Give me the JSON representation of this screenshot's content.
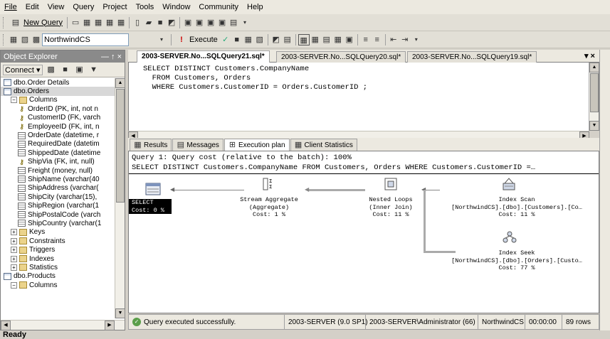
{
  "menu": [
    "File",
    "Edit",
    "View",
    "Query",
    "Project",
    "Tools",
    "Window",
    "Community",
    "Help"
  ],
  "toolbar1": {
    "new_query": "New Query"
  },
  "toolbar2": {
    "database": "NorthwindCS",
    "execute": "Execute"
  },
  "object_explorer": {
    "title": "Object Explorer",
    "pin": "— ↑ ×",
    "connect": "Connect ▾",
    "items": [
      {
        "label": "dbo.Order Details",
        "indent": 0,
        "icon": "table-icon",
        "expander": ""
      },
      {
        "label": "dbo.Orders",
        "indent": 0,
        "icon": "table-icon",
        "expander": "",
        "selected": true
      },
      {
        "label": "Columns",
        "indent": 1,
        "icon": "folder-icon",
        "expander": "−"
      },
      {
        "label": "OrderID (PK, int, not n",
        "indent": 2,
        "icon": "key-icon",
        "expander": ""
      },
      {
        "label": "CustomerID (FK, varch",
        "indent": 2,
        "icon": "key-icon",
        "expander": ""
      },
      {
        "label": "EmployeeID (FK, int, n",
        "indent": 2,
        "icon": "key-icon",
        "expander": ""
      },
      {
        "label": "OrderDate (datetime, r",
        "indent": 2,
        "icon": "column-icon",
        "expander": ""
      },
      {
        "label": "RequiredDate (datetim",
        "indent": 2,
        "icon": "column-icon",
        "expander": ""
      },
      {
        "label": "ShippedDate (datetime",
        "indent": 2,
        "icon": "column-icon",
        "expander": ""
      },
      {
        "label": "ShipVia (FK, int, null)",
        "indent": 2,
        "icon": "key-icon",
        "expander": ""
      },
      {
        "label": "Freight (money, null)",
        "indent": 2,
        "icon": "column-icon",
        "expander": ""
      },
      {
        "label": "ShipName (varchar(40",
        "indent": 2,
        "icon": "column-icon",
        "expander": ""
      },
      {
        "label": "ShipAddress (varchar(",
        "indent": 2,
        "icon": "column-icon",
        "expander": ""
      },
      {
        "label": "ShipCity (varchar(15), ",
        "indent": 2,
        "icon": "column-icon",
        "expander": ""
      },
      {
        "label": "ShipRegion (varchar(1",
        "indent": 2,
        "icon": "column-icon",
        "expander": ""
      },
      {
        "label": "ShipPostalCode (varch",
        "indent": 2,
        "icon": "column-icon",
        "expander": ""
      },
      {
        "label": "ShipCountry (varchar(1",
        "indent": 2,
        "icon": "column-icon",
        "expander": ""
      },
      {
        "label": "Keys",
        "indent": 1,
        "icon": "folder-icon",
        "expander": "+"
      },
      {
        "label": "Constraints",
        "indent": 1,
        "icon": "folder-icon",
        "expander": "+"
      },
      {
        "label": "Triggers",
        "indent": 1,
        "icon": "folder-icon",
        "expander": "+"
      },
      {
        "label": "Indexes",
        "indent": 1,
        "icon": "folder-icon",
        "expander": "+"
      },
      {
        "label": "Statistics",
        "indent": 1,
        "icon": "folder-icon",
        "expander": "+"
      },
      {
        "label": "dbo.Products",
        "indent": 0,
        "icon": "table-icon",
        "expander": ""
      },
      {
        "label": "Columns",
        "indent": 1,
        "icon": "folder-icon",
        "expander": "−"
      }
    ]
  },
  "doc_tabs": [
    {
      "label": "2003-SERVER.No...SQLQuery21.sql*",
      "active": true
    },
    {
      "label": "2003-SERVER.No...SQLQuery20.sql*",
      "active": false
    },
    {
      "label": "2003-SERVER.No...SQLQuery19.sql*",
      "active": false
    }
  ],
  "doc_tab_controls": "▾ ×",
  "editor_text": "SELECT DISTINCT Customers.CompanyName\n  FROM Customers, Orders\n  WHERE Customers.CustomerID = Orders.CustomerID ;",
  "result_tabs": [
    "Results",
    "Messages",
    "Execution plan",
    "Client Statistics"
  ],
  "active_result_tab": "Execution plan",
  "plan": {
    "header_line1": "Query 1: Query cost (relative to the batch): 100%",
    "header_line2": "SELECT DISTINCT Customers.CompanyName FROM Customers, Orders WHERE Customers.CustomerID =…",
    "nodes": [
      {
        "name": "select-node",
        "text": "SELECT\nCost: 0 %"
      },
      {
        "name": "stream-aggregate-node",
        "text": "Stream Aggregate\n(Aggregate)\nCost: 1 %"
      },
      {
        "name": "nested-loops-node",
        "text": "Nested Loops\n(Inner Join)\nCost: 11 %"
      },
      {
        "name": "index-scan-node",
        "text": "Index Scan\n[NorthwindCS].[dbo].[Customers].[Co…\nCost: 11 %"
      },
      {
        "name": "index-seek-node",
        "text": "Index Seek\n[NorthwindCS].[dbo].[Orders].[Custo…\nCost: 77 %"
      }
    ]
  },
  "query_status": {
    "message": "Query executed successfully.",
    "server": "2003-SERVER (9.0 SP1)",
    "user": "2003-SERVER\\Administrator (66)",
    "database": "NorthwindCS",
    "time": "00:00:00",
    "rows": "89 rows"
  },
  "status": "Ready"
}
